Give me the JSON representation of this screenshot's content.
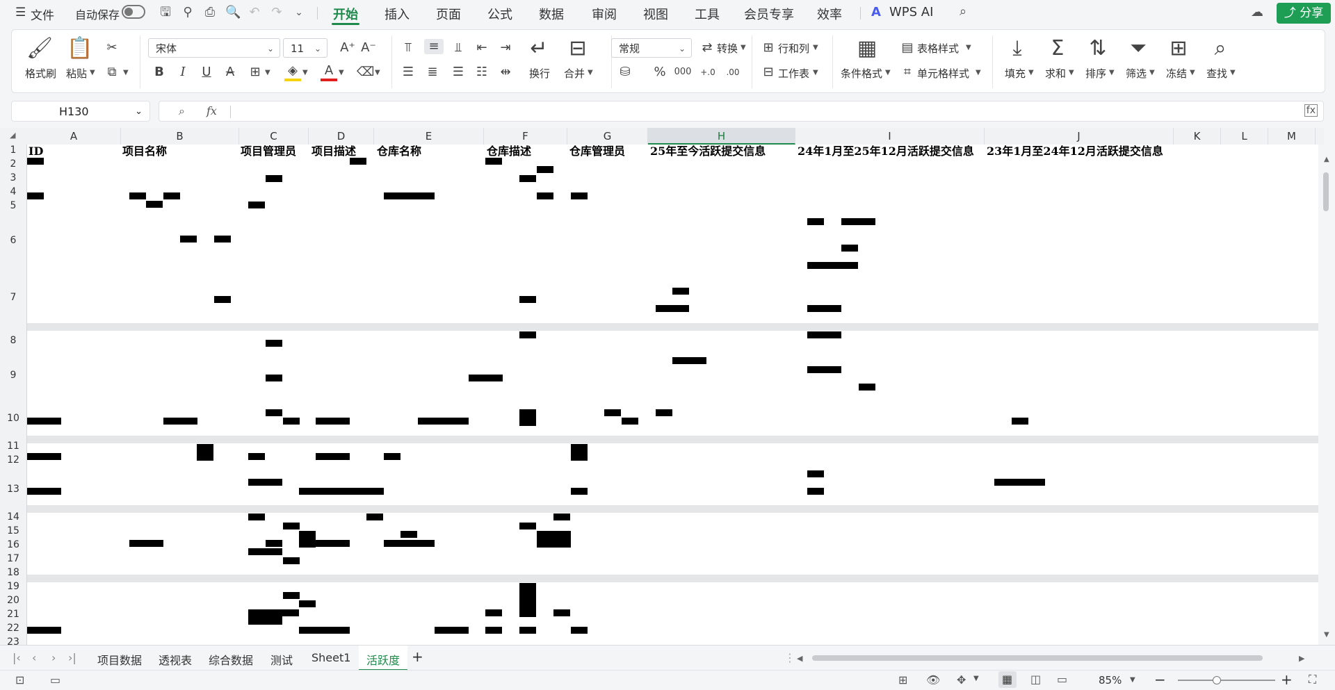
{
  "menubar": {
    "file_label": "文件",
    "autosave_label": "自动保存",
    "tabs": [
      "开始",
      "插入",
      "页面",
      "公式",
      "数据",
      "审阅",
      "视图",
      "工具",
      "会员专享",
      "效率"
    ],
    "wps_ai_label": "WPS AI",
    "share_label": "分享",
    "accent_color": "#1e8a4c"
  },
  "ribbon": {
    "format_painter": "格式刷",
    "paste": "粘贴",
    "font_name": "宋体",
    "font_size": "11",
    "wrap": "换行",
    "merge": "合并",
    "number_format": "常规",
    "convert": "转换",
    "rows_cols": "行和列",
    "worksheet": "工作表",
    "cond_format": "条件格式",
    "table_style": "表格样式",
    "cell_style": "单元格样式",
    "fill": "填充",
    "sum": "求和",
    "sort": "排序",
    "filter": "筛选",
    "freeze": "冻结",
    "find": "查找"
  },
  "formula": {
    "cell_ref": "H130",
    "fx": "fx",
    "content": ""
  },
  "columns": [
    "A",
    "B",
    "C",
    "D",
    "E",
    "F",
    "G",
    "H",
    "I",
    "J",
    "K",
    "L",
    "M"
  ],
  "selected_column": "H",
  "rows": [
    "1",
    "2",
    "3",
    "4",
    "5",
    "6",
    "7",
    "8",
    "9",
    "10",
    "11",
    "12",
    "13",
    "14",
    "15",
    "16",
    "17",
    "18",
    "19",
    "20",
    "21",
    "22",
    "23"
  ],
  "header_cells": [
    "ID",
    "项目名称",
    "项目管理员",
    "项目描述",
    "仓库名称",
    "仓库描述",
    "仓库管理员",
    "25年至今活跃提交信息",
    "24年1月至25年12月活跃提交信息",
    "23年1月至24年12月活跃提交信息"
  ],
  "sheet_tabs": [
    "项目数据",
    "透视表",
    "综合数据",
    "测试",
    "Sheet1",
    "活跃度"
  ],
  "active_sheet": "活跃度",
  "status": {
    "zoom": "85%"
  }
}
